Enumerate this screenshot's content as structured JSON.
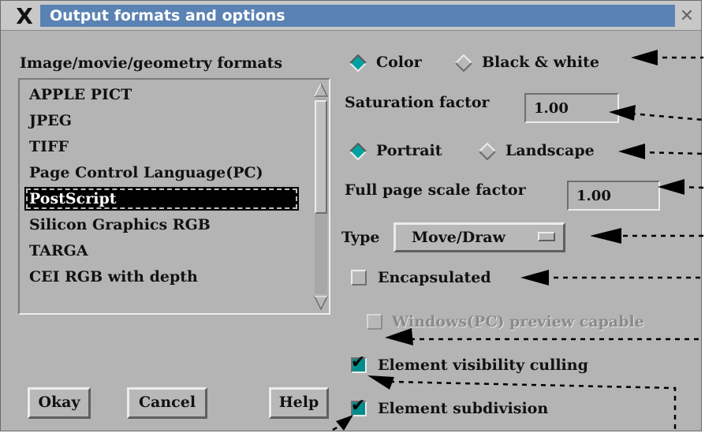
{
  "window": {
    "title": "Output formats and options",
    "logo_icon": "x-logo-icon",
    "close_icon": "close-icon"
  },
  "formats": {
    "heading": "Image/movie/geometry formats",
    "items": [
      {
        "label": "APPLE PICT",
        "selected": false
      },
      {
        "label": "JPEG",
        "selected": false
      },
      {
        "label": "TIFF",
        "selected": false
      },
      {
        "label": "Page Control Language(PC)",
        "selected": false
      },
      {
        "label": "PostScript",
        "selected": true
      },
      {
        "label": "Silicon Graphics RGB",
        "selected": false
      },
      {
        "label": "TARGA",
        "selected": false
      },
      {
        "label": "CEI RGB with depth",
        "selected": false
      }
    ]
  },
  "buttons": {
    "okay": "Okay",
    "cancel": "Cancel",
    "help": "Help"
  },
  "color_mode": {
    "color_label": "Color",
    "bw_label": "Black & white",
    "selected": "Color"
  },
  "saturation": {
    "label": "Saturation factor",
    "value": "1.00"
  },
  "orientation": {
    "portrait_label": "Portrait",
    "landscape_label": "Landscape",
    "selected": "Portrait"
  },
  "scale": {
    "label": "Full page scale factor",
    "value": "1.00"
  },
  "type": {
    "label": "Type",
    "value": "Move/Draw"
  },
  "checkboxes": {
    "encapsulated": {
      "label": "Encapsulated",
      "checked": false,
      "enabled": true
    },
    "windows_preview": {
      "label": "Windows(PC) preview capable",
      "checked": false,
      "enabled": false
    },
    "visibility_culling": {
      "label": "Element visibility culling",
      "checked": true,
      "enabled": true
    },
    "subdivision": {
      "label": "Element subdivision",
      "checked": true,
      "enabled": true
    }
  },
  "colors": {
    "title_bar": "#5a82b3",
    "panel": "#b4b4b4",
    "radio_selected": "#00a0a0",
    "check_selected": "#008c8c",
    "selection": "#000000"
  }
}
